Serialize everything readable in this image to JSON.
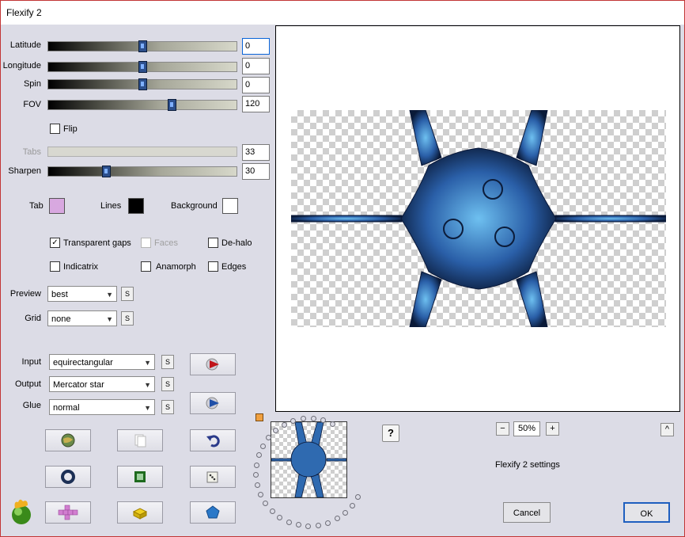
{
  "window": {
    "title": "Flexify 2"
  },
  "sliders": [
    {
      "label": "Latitude",
      "value": "0",
      "level": 0.5,
      "disabled": false
    },
    {
      "label": "Longitude",
      "value": "0",
      "level": 0.5,
      "disabled": false
    },
    {
      "label": "Spin",
      "value": "0",
      "level": 0.5,
      "disabled": false
    },
    {
      "label": "FOV",
      "value": "120",
      "level": 0.65,
      "disabled": false
    },
    {
      "label": "Tabs",
      "value": "33",
      "level": 0.33,
      "disabled": true
    },
    {
      "label": "Sharpen",
      "value": "30",
      "level": 0.3,
      "disabled": false
    }
  ],
  "flip": {
    "label": "Flip",
    "checked": false
  },
  "colors": {
    "tab": {
      "label": "Tab",
      "color": "#d8a8e0"
    },
    "lines": {
      "label": "Lines",
      "color": "#000000"
    },
    "background": {
      "label": "Background",
      "color": "#ffffff"
    }
  },
  "checks": {
    "transparent_gaps": {
      "label": "Transparent gaps",
      "checked": true
    },
    "faces": {
      "label": "Faces",
      "checked": false,
      "disabled": true
    },
    "de_halo": {
      "label": "De-halo",
      "checked": false
    },
    "indicatrix": {
      "label": "Indicatrix",
      "checked": false
    },
    "anamorph": {
      "label": "Anamorph",
      "checked": false
    },
    "edges": {
      "label": "Edges",
      "checked": false
    }
  },
  "preview_select": {
    "label": "Preview",
    "value": "best"
  },
  "grid_select": {
    "label": "Grid",
    "value": "none"
  },
  "input_select": {
    "label": "Input",
    "value": "equirectangular"
  },
  "output_select": {
    "label": "Output",
    "value": "Mercator star"
  },
  "glue_select": {
    "label": "Glue",
    "value": "normal"
  },
  "s_glyph": "S",
  "zoom": {
    "minus": "−",
    "value": "50%",
    "plus": "+"
  },
  "scroll_up": "^",
  "help": "?",
  "settings_label": "Flexify 2 settings",
  "buttons": {
    "cancel": "Cancel",
    "ok": "OK"
  }
}
